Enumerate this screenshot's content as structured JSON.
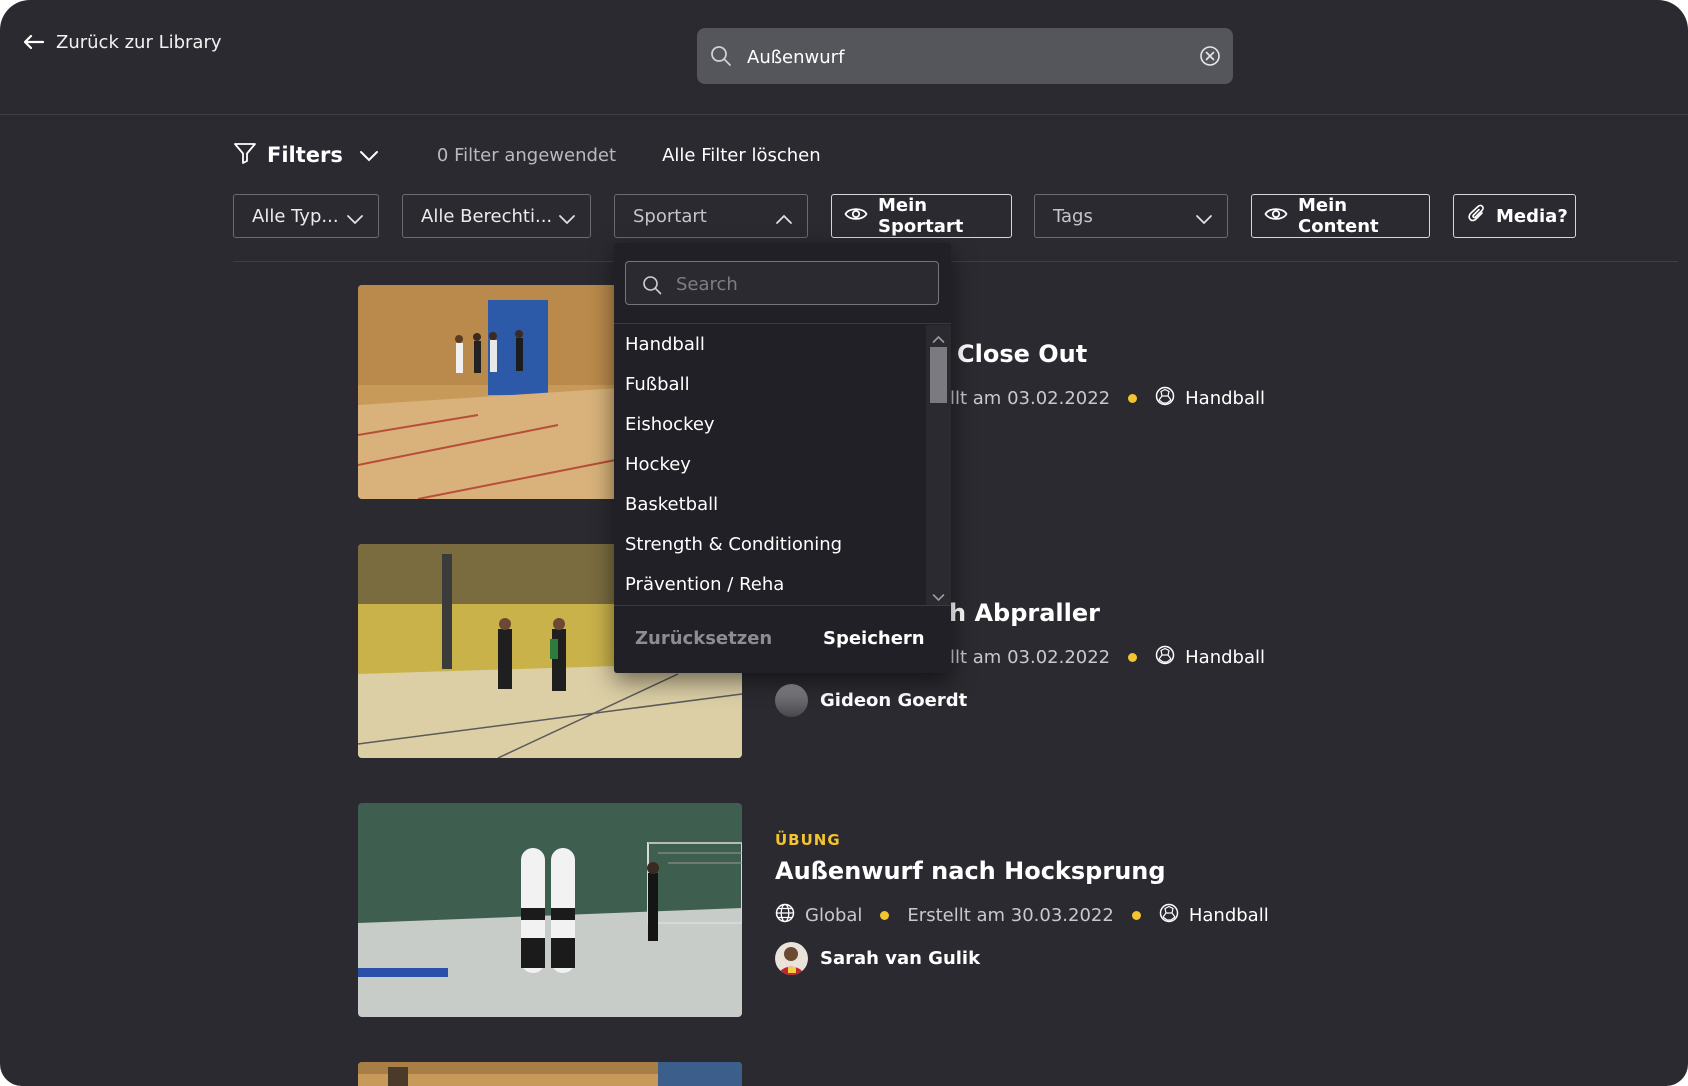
{
  "header": {
    "back_label": "Zurück zur Library",
    "search_value": "Außenwurf"
  },
  "filters": {
    "title": "Filters",
    "applied_count": "0 Filter angewendet",
    "clear_all": "Alle Filter löschen",
    "chips": {
      "type": "Alle Typ...",
      "permissions": "Alle Berechti...",
      "sport": "Sportart",
      "my_sport": "Mein Sportart",
      "tags": "Tags",
      "my_content": "Mein Content",
      "media": "Media?"
    }
  },
  "dropdown": {
    "search_placeholder": "Search",
    "items": [
      "Handball",
      "Fußball",
      "Eishockey",
      "Hockey",
      "Basketball",
      "Strength & Conditioning",
      "Prävention / Reha"
    ],
    "reset_label": "Zurücksetzen",
    "save_label": "Speichern"
  },
  "cards": [
    {
      "title_visible": "Close Out",
      "created_visible": "llt am 03.02.2022",
      "sport": "Handball",
      "extra_visible": ":"
    },
    {
      "title_visible": "h Abpraller",
      "created_visible": "llt am 03.02.2022",
      "sport": "Handball",
      "author": "Gideon Goerdt"
    },
    {
      "type": "ÜBUNG",
      "title": "Außenwurf nach Hocksprung",
      "visibility": "Global",
      "created": "Erstellt am 30.03.2022",
      "sport": "Handball",
      "author": "Sarah van Gulik"
    }
  ],
  "colors": {
    "background": "#2a2a30",
    "accent": "#f3c330",
    "search_bg": "#55555c",
    "dropdown_bg": "#202026"
  }
}
